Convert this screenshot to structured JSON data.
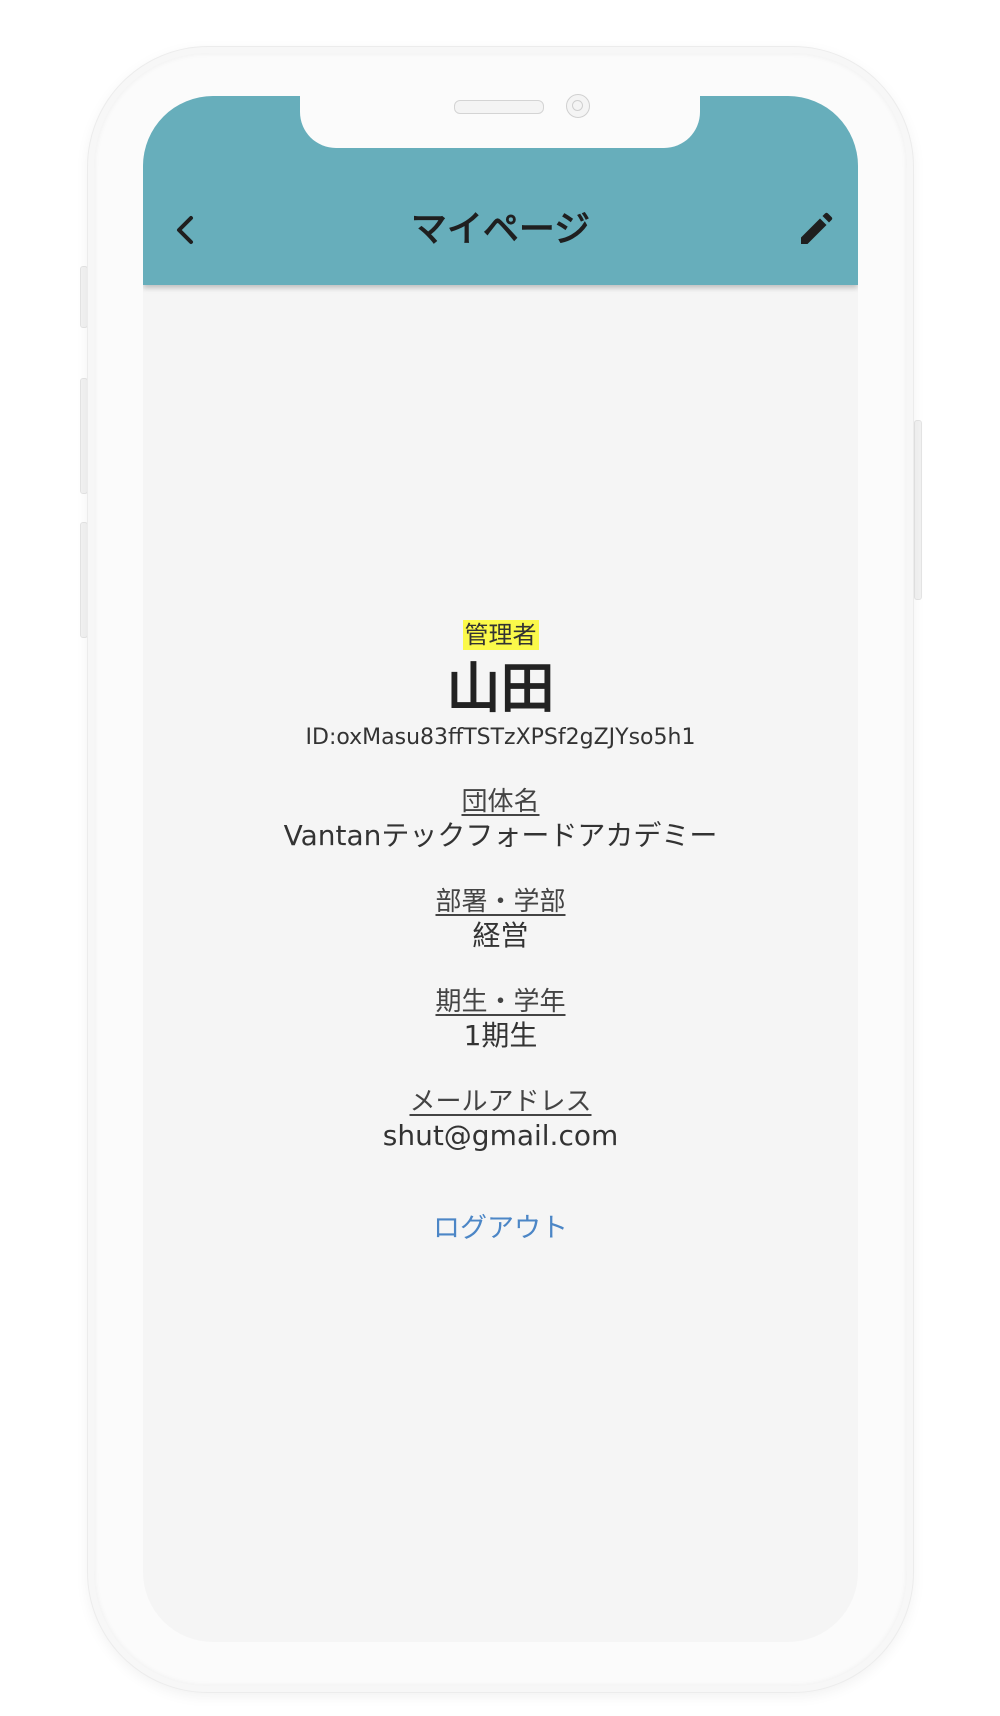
{
  "appbar": {
    "title": "マイページ",
    "background_color": "#67aebb",
    "back_icon": "chevron-left-icon",
    "edit_icon": "pencil-icon"
  },
  "profile": {
    "role": "管理者",
    "role_highlight_color": "#fbf94a",
    "name": "山田",
    "id_text": "ID:oxMasu83ffTSTzXPSf2gZJYso5h1",
    "fields": [
      {
        "label": "団体名",
        "value": "Vantanテックフォードアカデミー"
      },
      {
        "label": "部署・学部",
        "value": "経営"
      },
      {
        "label": "期生・学年",
        "value": "1期生"
      },
      {
        "label": "メールアドレス",
        "value": "shut@gmail.com"
      }
    ],
    "logout_label": "ログアウト",
    "logout_color": "#4c86c6"
  }
}
